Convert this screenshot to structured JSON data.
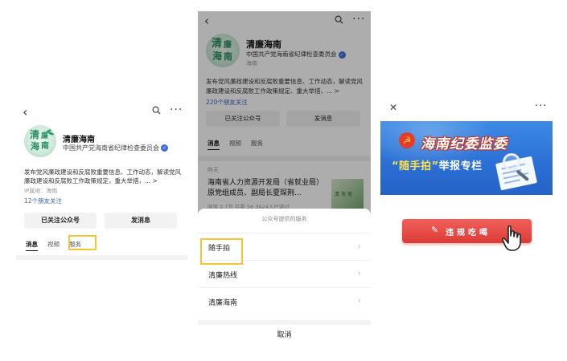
{
  "account": {
    "name": "清廉海南",
    "org": "中国共产党海南省纪律检查委员会",
    "desc_p1": "发布党风廉政建设和反腐败重要信息、工作动态，解读党风廉政建设和反腐败工作政策规定，重大举措，... >",
    "desc_p2": "发布党风廉政建设和反腐败重要信息、工作动态，解读党风廉政建设和反腐败工作政策规定、重大举措，... >",
    "ip": "IP属地：海南",
    "ip_short": "海南",
    "friends_p1": "12个朋友关注",
    "friends_p2": "220个朋友关注",
    "logo_text_1": "清",
    "logo_text_2": "廉",
    "logo_text_3": "海",
    "logo_text_4": "南"
  },
  "icons": {
    "back": "‹",
    "search": "🔍",
    "more": "···",
    "verified": "✓",
    "close": "✕",
    "chevron": "›",
    "pen": "✎",
    "emblem": "☭",
    "hand": "hand-pointer-icon"
  },
  "buttons": {
    "followed_p1": "已关注公众号",
    "message_p1": "发消息",
    "followed_p2": "已关注公众号",
    "message_p2": "发消息"
  },
  "tabs": {
    "messages": "消息",
    "videos": "视频",
    "services": "服务"
  },
  "feed": {
    "date": "昨天",
    "article_title": "海南省人力资源开发局（省就业局）原党组成员、副局长夏琛荆...",
    "meta": "阅读 2.7万  在看 56  3624人已读过",
    "thumb_text": "清 海 南"
  },
  "service_sheet": {
    "title": "公众号提供的服务",
    "items": [
      {
        "label": "随手拍"
      },
      {
        "label": "清廉热线"
      },
      {
        "label": "清廉海南"
      }
    ],
    "cancel": "取消"
  },
  "page3": {
    "banner_title": "海南纪委监委",
    "banner_sub_quote_open": "“",
    "banner_sub_quote_word": "随手拍",
    "banner_sub_quote_close": "”",
    "banner_sub_rest": "举报专栏",
    "report_button": "违规吃喝"
  },
  "colors": {
    "highlight": "#f3c732",
    "link_blue": "#3a62b8",
    "verified_blue": "#3f6bdc",
    "banner_blue": "#2b6fd4",
    "button_red": "#dd3b36"
  }
}
